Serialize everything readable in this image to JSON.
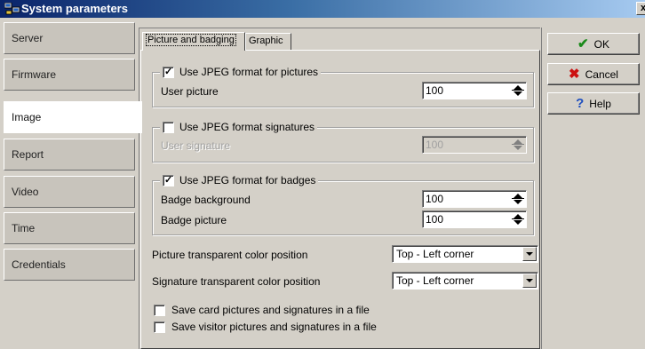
{
  "window": {
    "title": "System parameters",
    "close_glyph": "x"
  },
  "sidebar": {
    "items": [
      {
        "label": "Server"
      },
      {
        "label": "Firmware"
      },
      {
        "label": "Image"
      },
      {
        "label": "Report"
      },
      {
        "label": "Video"
      },
      {
        "label": "Time"
      },
      {
        "label": "Credentials"
      }
    ],
    "active": "Image"
  },
  "tabs": [
    {
      "label": "Picture and badging"
    },
    {
      "label": "Graphic"
    }
  ],
  "pictures": {
    "checkbox_label": "Use JPEG format for pictures",
    "checked": true,
    "user_picture_label": "User picture",
    "user_picture_value": "100"
  },
  "signatures": {
    "checkbox_label": "Use JPEG format signatures",
    "checked": false,
    "user_signature_label": "User signature",
    "user_signature_value": "100"
  },
  "badges": {
    "checkbox_label": "Use JPEG format for badges",
    "checked": true,
    "background_label": "Badge background",
    "background_value": "100",
    "picture_label": "Badge picture",
    "picture_value": "100"
  },
  "transparency": {
    "picture_label": "Picture transparent color position",
    "picture_value": "Top - Left corner",
    "signature_label": "Signature transparent color position",
    "signature_value": "Top - Left corner"
  },
  "files": {
    "save_card_label": "Save card pictures and signatures in a file",
    "save_card_checked": false,
    "save_visitor_label": "Save visitor pictures and signatures in a file",
    "save_visitor_checked": false
  },
  "buttons": {
    "ok_label": "OK",
    "cancel_label": "Cancel",
    "help_label": "Help"
  },
  "colors": {
    "ok_icon": "#1a8a1a",
    "cancel_icon": "#cc1111",
    "help_icon": "#1f4fbf"
  },
  "icons": {
    "window": "system-parameters-icon",
    "ok": "checkmark-icon",
    "cancel": "red-x-icon",
    "help": "question-mark-icon"
  }
}
